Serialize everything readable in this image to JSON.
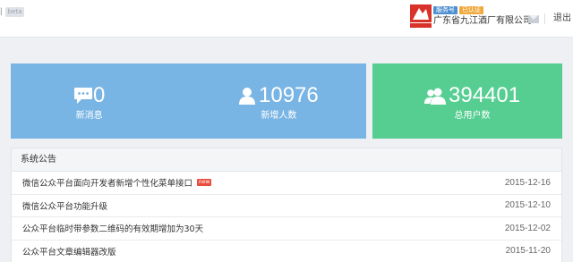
{
  "header": {
    "left_mark": "ǀ",
    "beta_label": "beta",
    "account": {
      "service_badge": "服务号",
      "verified_badge": "已认证",
      "name": "广东省九江酒厂有限公司"
    },
    "logout_label": "退出"
  },
  "stats": {
    "new_messages": {
      "value": "0",
      "label": "新消息"
    },
    "new_followers": {
      "value": "10976",
      "label": "新增人数"
    },
    "total_users": {
      "value": "394401",
      "label": "总用户数"
    }
  },
  "notices": {
    "title": "系统公告",
    "items": [
      {
        "title": "微信公众平台面向开发者新增个性化菜单接口",
        "new_tag": "new",
        "date": "2015-12-16"
      },
      {
        "title": "微信公众平台功能升级",
        "date": "2015-12-10"
      },
      {
        "title": "公众平台临时带参数二维码的有效期增加为30天",
        "date": "2015-12-02"
      },
      {
        "title": "公众平台文章编辑器改版",
        "date": "2015-11-20"
      }
    ]
  },
  "colors": {
    "blue_panel": "#79b5e4",
    "green_panel": "#56ce92",
    "new_tag": "#e94e3d",
    "service_badge": "#4e8fd0",
    "verified_badge": "#f0a93b"
  }
}
